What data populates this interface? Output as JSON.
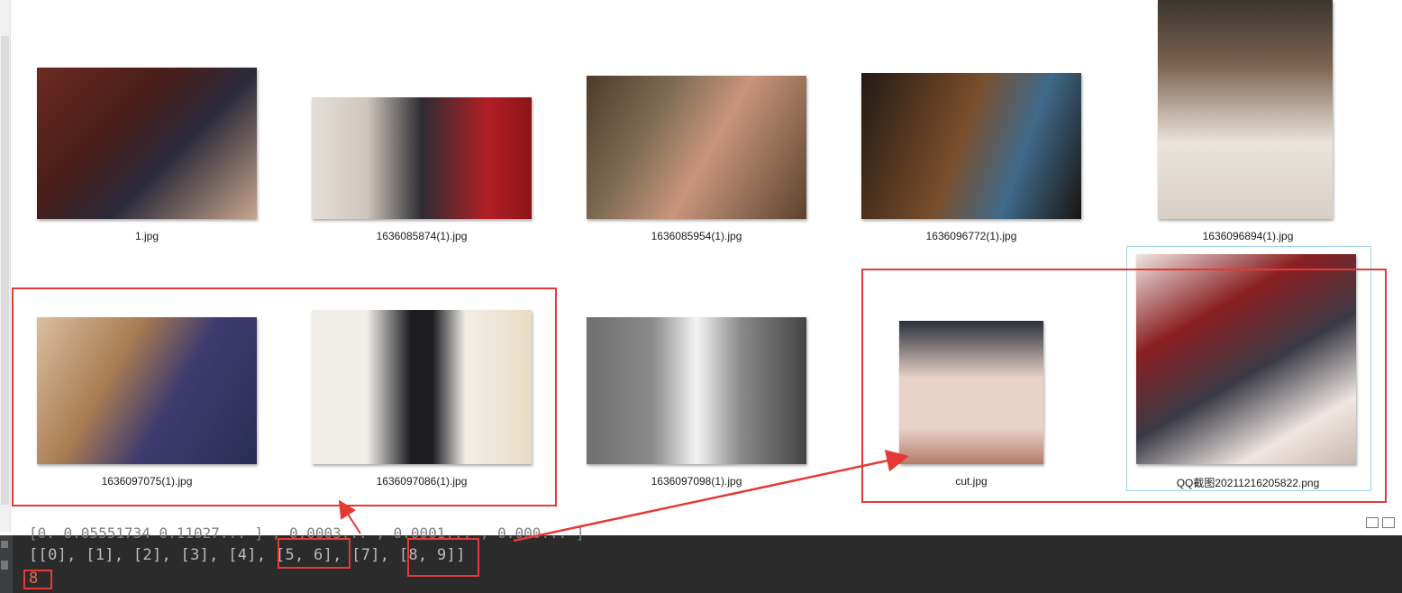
{
  "files": [
    {
      "name": "1.jpg",
      "colors": [
        "#6b2a22",
        "#2a2a3a",
        "#c9a58c"
      ]
    },
    {
      "name": "1636085874(1).jpg",
      "colors": [
        "#b21f24",
        "#e4ded8",
        "#2d2d33"
      ]
    },
    {
      "name": "1636085954(1).jpg",
      "colors": [
        "#4f3a27",
        "#c9957b",
        "#7e6b55"
      ]
    },
    {
      "name": "1636096772(1).jpg",
      "colors": [
        "#231a14",
        "#7a4e2b",
        "#3f6a8a"
      ]
    },
    {
      "name": "1636096894(1).jpg",
      "colors": [
        "#3a3530",
        "#e9e3dc",
        "#7c6350"
      ]
    },
    {
      "name": "1636097075(1).jpg",
      "colors": [
        "#d9bfa0",
        "#3e3b6e",
        "#a97c52"
      ]
    },
    {
      "name": "1636097086(1).jpg",
      "colors": [
        "#f1eee9",
        "#1e1e22",
        "#e9dcc4"
      ]
    },
    {
      "name": "1636097098(1).jpg",
      "colors": [
        "#6f6f6f",
        "#f4f4f4",
        "#444444"
      ]
    },
    {
      "name": "cut.jpg",
      "colors": [
        "#2a2f3a",
        "#e8d2c8",
        "#b57a6a"
      ]
    },
    {
      "name": "QQ截图20211216205822.png",
      "colors": [
        "#8a1f22",
        "#efe6e2",
        "#3a3a44"
      ]
    }
  ],
  "console": {
    "prev_line": "[0. 0.05551734 0.11027... ]  , 0.0003...  , 0.0001... , 0.000... ]",
    "output_line": "[[0], [1], [2], [3], [4], [5, 6], [7], [8, 9]]",
    "count_line": "8"
  },
  "annotation_color": "#e53935"
}
